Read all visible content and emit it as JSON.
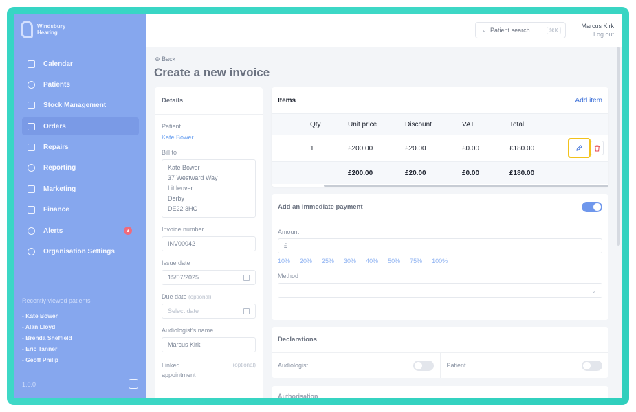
{
  "brand": {
    "line1": "Windsbury",
    "line2": "Hearing"
  },
  "sidebar": {
    "items": [
      {
        "label": "Calendar",
        "icon": "calendar-icon"
      },
      {
        "label": "Patients",
        "icon": "patients-icon"
      },
      {
        "label": "Stock Management",
        "icon": "stock-icon"
      },
      {
        "label": "Orders",
        "icon": "orders-icon",
        "active": true
      },
      {
        "label": "Repairs",
        "icon": "wrench-icon"
      },
      {
        "label": "Reporting",
        "icon": "chart-icon"
      },
      {
        "label": "Marketing",
        "icon": "mail-icon"
      },
      {
        "label": "Finance",
        "icon": "card-icon"
      },
      {
        "label": "Alerts",
        "icon": "bell-icon",
        "badge": "3"
      },
      {
        "label": "Organisation Settings",
        "icon": "gear-icon"
      }
    ],
    "recent_title": "Recently viewed patients",
    "recent": [
      "- Kate Bower",
      "- Alan Lloyd",
      "- Brenda Sheffield",
      "- Eric Tanner",
      "- Geoff Philip"
    ],
    "version": "1.0.0"
  },
  "topbar": {
    "search_label": "Patient search",
    "search_shortcut": "⌘K",
    "user_name": "Marcus Kirk",
    "logout": "Log out"
  },
  "page": {
    "back": "Back",
    "title": "Create a new invoice"
  },
  "details": {
    "title": "Details",
    "patient_label": "Patient",
    "patient_value": "Kate Bower",
    "bill_to_label": "Bill to",
    "bill_to_lines": [
      "Kate Bower",
      "37 Westward Way",
      "Littleover",
      "Derby",
      "DE22 3HC"
    ],
    "invoice_number_label": "Invoice number",
    "invoice_number": "INV00042",
    "issue_date_label": "Issue date",
    "issue_date": "15/07/2025",
    "due_date_label": "Due date",
    "due_date_optional": "(optional)",
    "due_date_placeholder": "Select date",
    "audiologist_label": "Audiologist's name",
    "audiologist_value": "Marcus Kirk",
    "linked_label": "Linked appointment",
    "linked_optional": "(optional)"
  },
  "items": {
    "title": "Items",
    "add_label": "Add item",
    "columns": [
      "Qty",
      "Unit price",
      "Discount",
      "VAT",
      "Total"
    ],
    "row": {
      "qty": "1",
      "unit": "£200.00",
      "discount": "£20.00",
      "vat": "£0.00",
      "total": "£180.00"
    },
    "totals": {
      "unit": "£200.00",
      "discount": "£20.00",
      "vat": "£0.00",
      "total": "£180.00"
    }
  },
  "payment": {
    "title": "Add an immediate payment",
    "enabled": true,
    "amount_label": "Amount",
    "currency_symbol": "£",
    "percentages": [
      "10%",
      "20%",
      "25%",
      "30%",
      "40%",
      "50%",
      "75%",
      "100%"
    ],
    "method_label": "Method"
  },
  "declarations": {
    "title": "Declarations",
    "audiologist_label": "Audiologist",
    "patient_label": "Patient",
    "audiologist_signed": false,
    "patient_signed": false
  },
  "next_section": {
    "title": "Authorisation"
  }
}
